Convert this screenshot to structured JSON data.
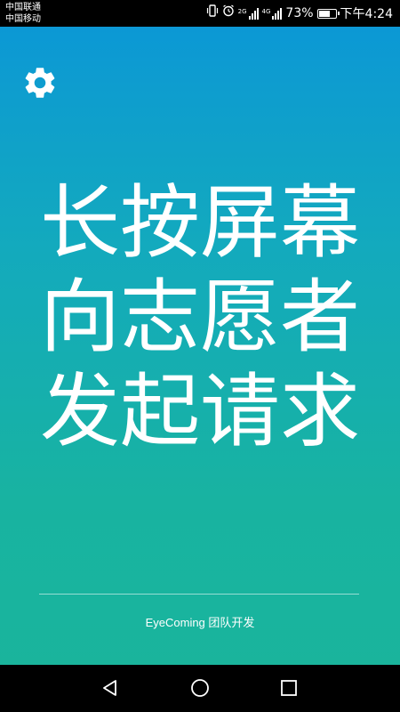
{
  "status_bar": {
    "carrier_1": "中国联通",
    "carrier_2": "中国移动",
    "network_1": "2G",
    "network_2": "4G",
    "battery_percent": "73%",
    "battery_level": 0.73,
    "time": "下午4:24"
  },
  "settings": {
    "icon": "gear-icon"
  },
  "headline": {
    "line_1": "长按屏幕",
    "line_2": "向志愿者",
    "line_3": "发起请求"
  },
  "footer": {
    "credit": "EyeComing 团队开发"
  },
  "nav_bar": {
    "back_icon": "back-triangle-icon",
    "home_icon": "home-circle-icon",
    "recents_icon": "recents-square-icon"
  },
  "colors": {
    "gradient_top": "#0b96d8",
    "gradient_bottom": "#1ab59b",
    "text": "#ffffff",
    "bars": "#000000"
  }
}
